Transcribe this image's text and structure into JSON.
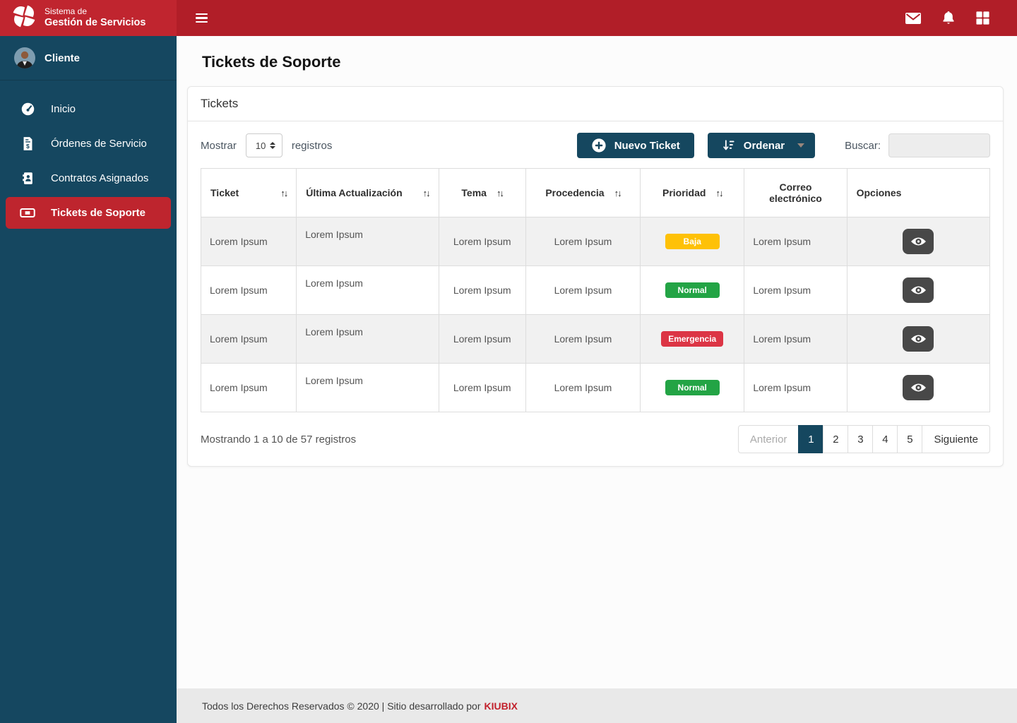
{
  "navbar": {
    "brand_line1": "Sistema de",
    "brand_line2": "Gestión de Servicios",
    "icon_names": [
      "logo-pinwheel-icon",
      "menu-icon",
      "mail-icon",
      "bell-icon",
      "apps-grid-icon"
    ]
  },
  "sidebar": {
    "user_name": "Cliente",
    "items": [
      {
        "id": "inicio",
        "label": "Inicio",
        "icon": "dashboard-icon",
        "active": false
      },
      {
        "id": "ordenes-de-servicio",
        "label": "Órdenes de Servicio",
        "icon": "service-order-icon",
        "active": false
      },
      {
        "id": "contratos-asignados",
        "label": "Contratos Asignados",
        "icon": "contracts-icon",
        "active": false
      },
      {
        "id": "tickets-de-soporte",
        "label": "Tickets de Soporte",
        "icon": "ticket-icon",
        "active": true
      }
    ]
  },
  "page": {
    "title": "Tickets de Soporte"
  },
  "panel": {
    "title": "Tickets",
    "show_label": "Mostrar",
    "page_size": "10",
    "records_label": "registros",
    "new_ticket_button": "Nuevo Ticket",
    "sort_button": "Ordenar",
    "search_label": "Buscar:",
    "search_value": ""
  },
  "table": {
    "columns": [
      {
        "id": "ticket",
        "label": "Ticket",
        "sortable": true,
        "header_align": "between"
      },
      {
        "id": "last-update",
        "label": "Última Actualización",
        "sortable": true,
        "header_align": "between"
      },
      {
        "id": "topic",
        "label": "Tema",
        "sortable": true,
        "header_align": "center"
      },
      {
        "id": "source",
        "label": "Procedencia",
        "sortable": true,
        "header_align": "center"
      },
      {
        "id": "priority",
        "label": "Prioridad",
        "sortable": true,
        "header_align": "center"
      },
      {
        "id": "email",
        "label": "Correo electrónico",
        "sortable": false,
        "header_align": "left"
      },
      {
        "id": "options",
        "label": "Opciones",
        "sortable": false,
        "header_align": "left"
      }
    ],
    "rows": [
      {
        "ticket": "Lorem Ipsum",
        "last_update": "Lorem Ipsum",
        "topic": "Lorem Ipsum",
        "source": "Lorem Ipsum",
        "priority": {
          "label": "Baja",
          "color": "#fec107"
        },
        "email": "Lorem Ipsum"
      },
      {
        "ticket": "Lorem Ipsum",
        "last_update": "Lorem Ipsum",
        "topic": "Lorem Ipsum",
        "source": "Lorem Ipsum",
        "priority": {
          "label": "Normal",
          "color": "#23a445"
        },
        "email": "Lorem Ipsum"
      },
      {
        "ticket": "Lorem Ipsum",
        "last_update": "Lorem Ipsum",
        "topic": "Lorem Ipsum",
        "source": "Lorem Ipsum",
        "priority": {
          "label": "Emergencia",
          "color": "#dc3545"
        },
        "email": "Lorem Ipsum"
      },
      {
        "ticket": "Lorem Ipsum",
        "last_update": "Lorem Ipsum",
        "topic": "Lorem Ipsum",
        "source": "Lorem Ipsum",
        "priority": {
          "label": "Normal",
          "color": "#23a445"
        },
        "email": "Lorem Ipsum"
      }
    ]
  },
  "pagination": {
    "summary": "Mostrando 1 a 10 de 57 registros",
    "prev_label": "Anterior",
    "pages": [
      "1",
      "2",
      "3",
      "4",
      "5"
    ],
    "active_page": "1",
    "next_label": "Siguiente"
  },
  "footer": {
    "text": "Todos los Derechos Reservados © 2020 | Sitio desarrollado por",
    "brand": "KIUBIX"
  },
  "icons": {
    "sort": "↑↓"
  },
  "colors": {
    "navbar_red": "#b11e28",
    "brand_red": "#c0252f",
    "sidebar_blue": "#154760",
    "active_item_red": "#be252e",
    "primary_blue": "#15475f",
    "badge_yellow": "#fec107",
    "badge_green": "#23a445",
    "badge_red": "#dc3545",
    "kiubix_red": "#c2212c"
  }
}
